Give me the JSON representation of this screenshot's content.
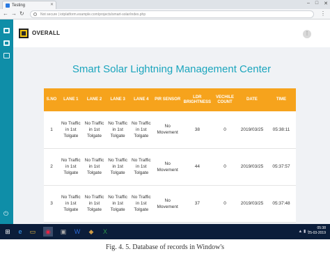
{
  "browser": {
    "tab_title": "Testing",
    "url_prefix": "Not secure",
    "url": "iotplatform.example.com/projects/smart-solar/index.php",
    "window_controls": [
      "–",
      "□",
      "✕"
    ]
  },
  "header": {
    "brand": "OVERALL",
    "menu_button": "⋮"
  },
  "page": {
    "title": "Smart Solar Lightning Management Center"
  },
  "table": {
    "headers": [
      "S.NO",
      "LANE 1",
      "LANE 2",
      "LANE 3",
      "LANE 4",
      "PIR SENSOR",
      "LDR BRIGHTNESS",
      "VECHILE COUNT",
      "DATE",
      "TIME"
    ],
    "rows": [
      {
        "sno": "1",
        "lanes": [
          "No Traffic in 1st Tolgate",
          "No Traffic in 1st Tolgate",
          "No Traffic in 1st Tolgate",
          "No Traffic in 1st Tolgate"
        ],
        "pir": "No Movement",
        "ldr": "38",
        "count": "0",
        "date": "2019/03/25",
        "time": "05:38:11"
      },
      {
        "sno": "2",
        "lanes": [
          "No Traffic in 1st Tolgate",
          "No Traffic in 1st Tolgate",
          "No Traffic in 1st Tolgate",
          "No Traffic in 1st Tolgate"
        ],
        "pir": "No Movement",
        "ldr": "44",
        "count": "0",
        "date": "2019/03/25",
        "time": "05:37:57"
      },
      {
        "sno": "3",
        "lanes": [
          "No Traffic in 1st Tolgate",
          "No Traffic in 1st Tolgate",
          "No Traffic in 1st Tolgate",
          "No Traffic in 1st Tolgate"
        ],
        "pir": "No Movement",
        "ldr": "37",
        "count": "0",
        "date": "2019/03/25",
        "time": "05:37:48"
      }
    ]
  },
  "taskbar": {
    "clock_time": "05:38",
    "clock_date": "25-03-2019"
  },
  "caption": "Fig. 4. 5. Database of records in Window's",
  "colors": {
    "accent": "#1ba5bd",
    "sidebar": "#0f8ea8",
    "table_header": "#f6a31c"
  }
}
